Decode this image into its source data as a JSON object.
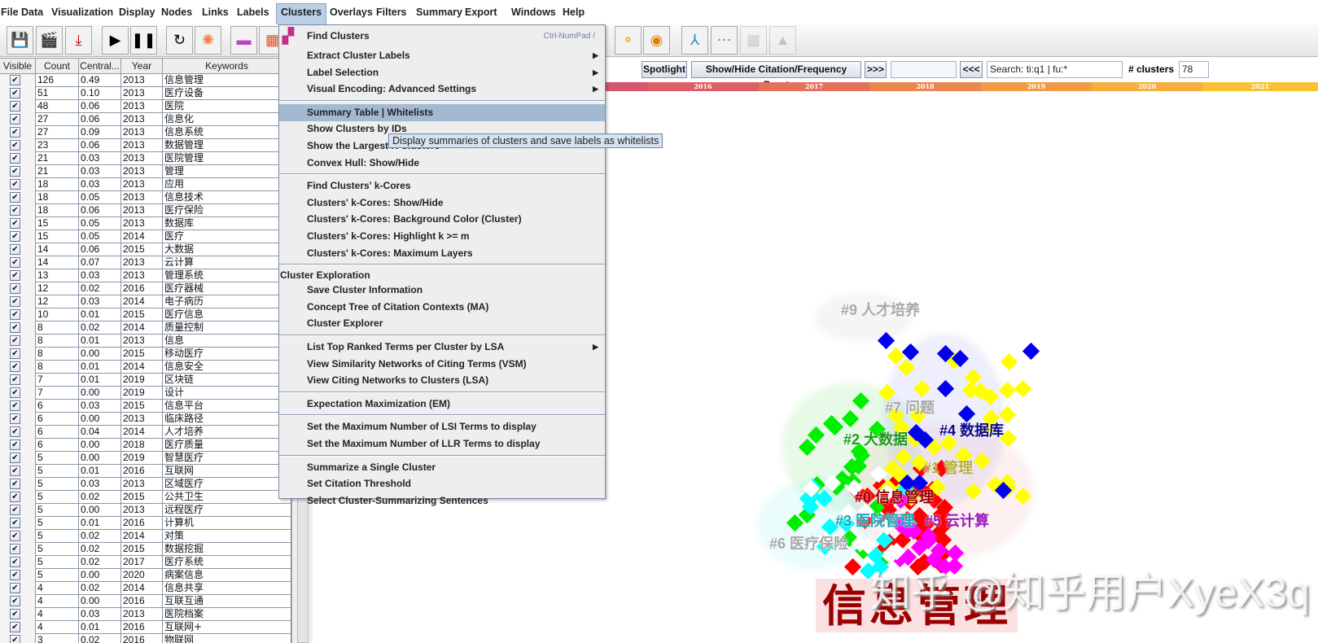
{
  "menubar": {
    "items": [
      "File",
      "Data",
      "Visualization",
      "Display",
      "Nodes",
      "Links",
      "Labels",
      "Clusters",
      "Overlays",
      "Filters",
      "Summary",
      "Export",
      "Windows",
      "Help"
    ],
    "active": "Clusters"
  },
  "toolbar": {
    "icons": [
      "save-icon",
      "clapperboard-icon",
      "pdf-export-icon",
      "play-icon",
      "pause-icon",
      "refresh-icon",
      "starburst-icon",
      "color-bar-icon",
      "color-grid-icon",
      "node-dots-icon",
      "chain-icon",
      "target-icon",
      "tree-icon",
      "network-icon",
      "gray-image-icon",
      "gray-tree-icon"
    ]
  },
  "table": {
    "columns": [
      "Visible",
      "Count",
      "Central...",
      "Year",
      "Keywords"
    ],
    "rows": [
      [
        126,
        "0.49",
        2013,
        "信息管理"
      ],
      [
        51,
        "0.10",
        2013,
        "医疗设备"
      ],
      [
        48,
        "0.06",
        2013,
        "医院"
      ],
      [
        27,
        "0.06",
        2013,
        "信息化"
      ],
      [
        27,
        "0.09",
        2013,
        "信息系统"
      ],
      [
        23,
        "0.06",
        2013,
        "数据管理"
      ],
      [
        21,
        "0.03",
        2013,
        "医院管理"
      ],
      [
        21,
        "0.03",
        2013,
        "管理"
      ],
      [
        18,
        "0.03",
        2013,
        "应用"
      ],
      [
        18,
        "0.05",
        2013,
        "信息技术"
      ],
      [
        18,
        "0.06",
        2013,
        "医疗保险"
      ],
      [
        15,
        "0.05",
        2013,
        "数据库"
      ],
      [
        15,
        "0.05",
        2014,
        "医疗"
      ],
      [
        14,
        "0.06",
        2015,
        "大数据"
      ],
      [
        14,
        "0.07",
        2013,
        "云计算"
      ],
      [
        13,
        "0.03",
        2013,
        "管理系统"
      ],
      [
        12,
        "0.02",
        2016,
        "医疗器械"
      ],
      [
        12,
        "0.03",
        2014,
        "电子病历"
      ],
      [
        10,
        "0.01",
        2015,
        "医疗信息"
      ],
      [
        8,
        "0.02",
        2014,
        "质量控制"
      ],
      [
        8,
        "0.01",
        2013,
        "信息"
      ],
      [
        8,
        "0.00",
        2015,
        "移动医疗"
      ],
      [
        8,
        "0.01",
        2014,
        "信息安全"
      ],
      [
        7,
        "0.01",
        2019,
        "区块链"
      ],
      [
        7,
        "0.00",
        2019,
        "设计"
      ],
      [
        6,
        "0.03",
        2015,
        "信息平台"
      ],
      [
        6,
        "0.00",
        2013,
        "临床路径"
      ],
      [
        6,
        "0.04",
        2014,
        "人才培养"
      ],
      [
        6,
        "0.00",
        2018,
        "医疗质量"
      ],
      [
        5,
        "0.00",
        2019,
        "智慧医疗"
      ],
      [
        5,
        "0.01",
        2016,
        "互联网"
      ],
      [
        5,
        "0.03",
        2013,
        "区域医疗"
      ],
      [
        5,
        "0.02",
        2015,
        "公共卫生"
      ],
      [
        5,
        "0.00",
        2013,
        "远程医疗"
      ],
      [
        5,
        "0.01",
        2016,
        "计算机"
      ],
      [
        5,
        "0.02",
        2014,
        "对策"
      ],
      [
        5,
        "0.02",
        2015,
        "数据挖掘"
      ],
      [
        5,
        "0.02",
        2017,
        "医疗系统"
      ],
      [
        5,
        "0.00",
        2020,
        "病案信息"
      ],
      [
        4,
        "0.02",
        2014,
        "信息共享"
      ],
      [
        4,
        "0.00",
        2016,
        "互联互通"
      ],
      [
        4,
        "0.03",
        2013,
        "医院档案"
      ],
      [
        4,
        "0.01",
        2016,
        "互联网+"
      ],
      [
        3,
        "0.02",
        2016,
        "物联网"
      ]
    ]
  },
  "clusters_menu": {
    "items": [
      {
        "label": "Find Clusters",
        "shortcut": "Ctrl-NumPad /",
        "icon": "find-clusters-icon"
      },
      {
        "label": "Extract Cluster Labels",
        "submenu": true
      },
      {
        "label": "Label Selection",
        "submenu": true
      },
      {
        "label": "Visual Encoding: Advanced Settings",
        "submenu": true
      },
      {
        "sep": true
      },
      {
        "label": "Summary Table | Whitelists",
        "highlighted": true
      },
      {
        "label": "Show Clusters by IDs"
      },
      {
        "label": "Show the Largest K Clusters"
      },
      {
        "label": "Convex Hull: Show/Hide"
      },
      {
        "sep": true
      },
      {
        "label": "Find Clusters' k-Cores"
      },
      {
        "label": "Clusters' k-Cores: Show/Hide"
      },
      {
        "label": "Clusters' k-Cores: Background Color (Cluster)"
      },
      {
        "label": "Clusters' k-Cores: Highlight k >= m"
      },
      {
        "label": "Clusters' k-Cores: Maximum Layers"
      },
      {
        "sep": true
      },
      {
        "header": "Cluster Exploration"
      },
      {
        "label": "Save Cluster Information"
      },
      {
        "label": "Concept Tree of Citation Contexts (MA)"
      },
      {
        "label": "Cluster Explorer"
      },
      {
        "sep": true
      },
      {
        "label": "List Top Ranked Terms per Cluster by LSA",
        "submenu": true
      },
      {
        "label": "View Similarity Networks of Citing Terms (VSM)"
      },
      {
        "label": "View Citing Networks to Clusters (LSA)"
      },
      {
        "sep": true
      },
      {
        "label": "Expectation Maximization (EM)"
      },
      {
        "sep": true
      },
      {
        "label": "Set the Maximum Number of LSI Terms to display"
      },
      {
        "label": "Set the Maximum Number of LLR Terms to display"
      },
      {
        "sep": true
      },
      {
        "label": "Summarize a Single Cluster"
      },
      {
        "label": "Set Citation Threshold"
      },
      {
        "label": "Select Cluster-Summarizing Sentences"
      }
    ],
    "tooltip": "Display summaries of clusters and save labels as whitelists"
  },
  "controls": {
    "spotlight": "Spotlight",
    "burst": "Show/Hide Citation/Frequency Burst",
    "next": ">>>",
    "prev": "<<<",
    "search_value": "Search: ti:q1 | fu:*",
    "clusters_label": "# clusters",
    "clusters_value": "78"
  },
  "timeline": [
    {
      "year": "",
      "color": "#d4566e"
    },
    {
      "year": "2016",
      "color": "#dc5e67"
    },
    {
      "year": "2017",
      "color": "#e4715b"
    },
    {
      "year": "2018",
      "color": "#ec8650"
    },
    {
      "year": "2019",
      "color": "#f19b47"
    },
    {
      "year": "2020",
      "color": "#f6ae3d"
    },
    {
      "year": "2021",
      "color": "#f9c232"
    }
  ],
  "clusters": [
    {
      "id": "#0",
      "label": "信息管理",
      "color": "#ff0000",
      "text_color": "#9a0000"
    },
    {
      "id": "#1",
      "label": "管理",
      "color": "#ffff00",
      "text_color": "#b7ae3c"
    },
    {
      "id": "#2",
      "label": "大数据",
      "color": "#00ee00",
      "text_color": "#1a9a1a"
    },
    {
      "id": "#3",
      "label": "医院管理",
      "color": "#00ffff",
      "text_color": "#1aa6b8"
    },
    {
      "id": "#4",
      "label": "数据库",
      "color": "#0000ee",
      "text_color": "#0a0a8c"
    },
    {
      "id": "#5",
      "label": "云计算",
      "color": "#ff00ff",
      "text_color": "#9a1ab8"
    },
    {
      "id": "#6",
      "label": "医疗保险",
      "color": "#ffffff",
      "text_color": "#a8a8a8"
    },
    {
      "id": "#7",
      "label": "问题",
      "color": "#ffffff",
      "text_color": "#a8a8a8"
    },
    {
      "id": "#9",
      "label": "人才培养",
      "color": "#ffffff",
      "text_color": "#a8a8a8"
    }
  ],
  "highlight_label": "信息管理",
  "watermark": "知乎 @知乎用户XyeX3q"
}
